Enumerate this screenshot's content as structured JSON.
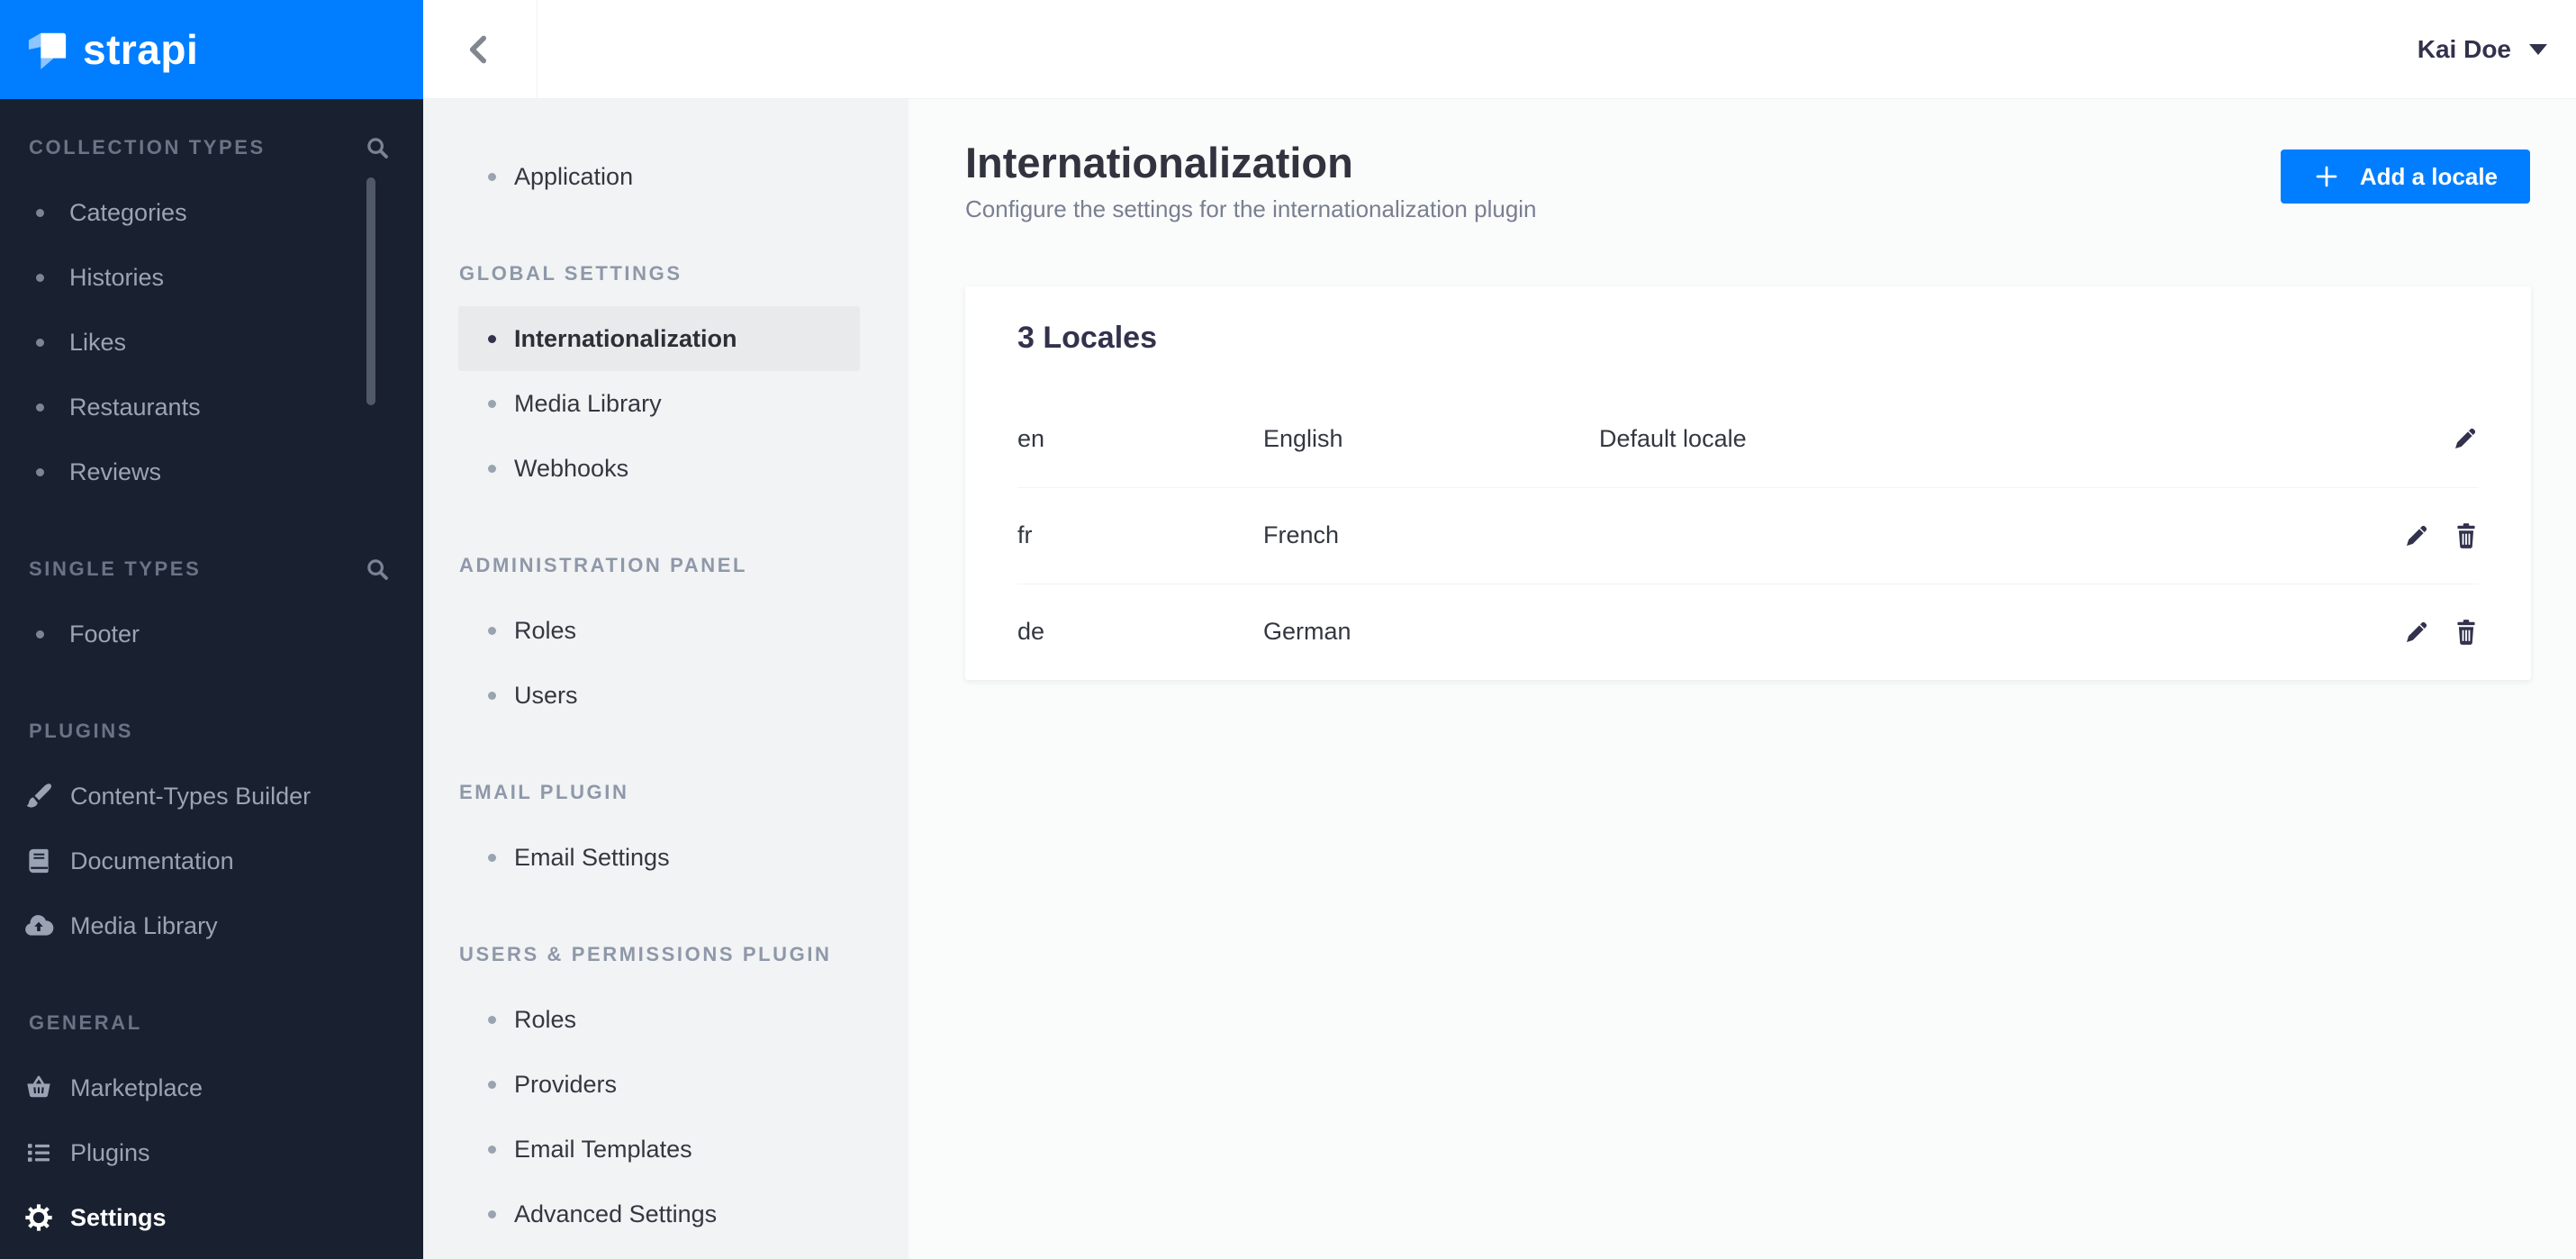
{
  "brand": {
    "logo_text": "strapi"
  },
  "topbar": {
    "user_name": "Kai Doe"
  },
  "colors": {
    "accent_blue": "#007eff",
    "sidebar_bg": "#192130",
    "subbar_bg": "#f2f3f4",
    "active_item_bg": "#e9eaeb",
    "main_bg": "#fafbfb",
    "text_dark": "#32324d"
  },
  "sidebar": {
    "sections": [
      {
        "label": "COLLECTION TYPES",
        "has_search": true,
        "items": [
          {
            "label": "Categories"
          },
          {
            "label": "Histories"
          },
          {
            "label": "Likes"
          },
          {
            "label": "Restaurants"
          },
          {
            "label": "Reviews"
          }
        ]
      },
      {
        "label": "SINGLE TYPES",
        "has_search": true,
        "items": [
          {
            "label": "Footer"
          }
        ]
      },
      {
        "label": "PLUGINS",
        "has_search": false,
        "items": [
          {
            "label": "Content-Types Builder",
            "icon": "paint-brush-icon"
          },
          {
            "label": "Documentation",
            "icon": "book-icon"
          },
          {
            "label": "Media Library",
            "icon": "cloud-upload-icon"
          }
        ]
      },
      {
        "label": "GENERAL",
        "has_search": false,
        "items": [
          {
            "label": "Marketplace",
            "icon": "basket-icon"
          },
          {
            "label": "Plugins",
            "icon": "list-icon"
          },
          {
            "label": "Settings",
            "icon": "gear-icon",
            "active": true
          }
        ]
      }
    ]
  },
  "subbar": {
    "application": {
      "label": "Application"
    },
    "sections": [
      {
        "label": "GLOBAL SETTINGS",
        "items": [
          {
            "label": "Internationalization",
            "active": true
          },
          {
            "label": "Media Library"
          },
          {
            "label": "Webhooks"
          }
        ]
      },
      {
        "label": "ADMINISTRATION PANEL",
        "items": [
          {
            "label": "Roles"
          },
          {
            "label": "Users"
          }
        ]
      },
      {
        "label": "EMAIL PLUGIN",
        "items": [
          {
            "label": "Email Settings"
          }
        ]
      },
      {
        "label": "USERS & PERMISSIONS PLUGIN",
        "items": [
          {
            "label": "Roles"
          },
          {
            "label": "Providers"
          },
          {
            "label": "Email Templates"
          },
          {
            "label": "Advanced Settings"
          }
        ]
      }
    ]
  },
  "main": {
    "title": "Internationalization",
    "subtitle": "Configure the settings for the internationalization plugin",
    "add_button_label": "Add a locale",
    "locales_card": {
      "title": "3 Locales",
      "rows": [
        {
          "code": "en",
          "name": "English",
          "default_label": "Default locale",
          "can_delete": false
        },
        {
          "code": "fr",
          "name": "French",
          "default_label": "",
          "can_delete": true
        },
        {
          "code": "de",
          "name": "German",
          "default_label": "",
          "can_delete": true
        }
      ]
    }
  }
}
